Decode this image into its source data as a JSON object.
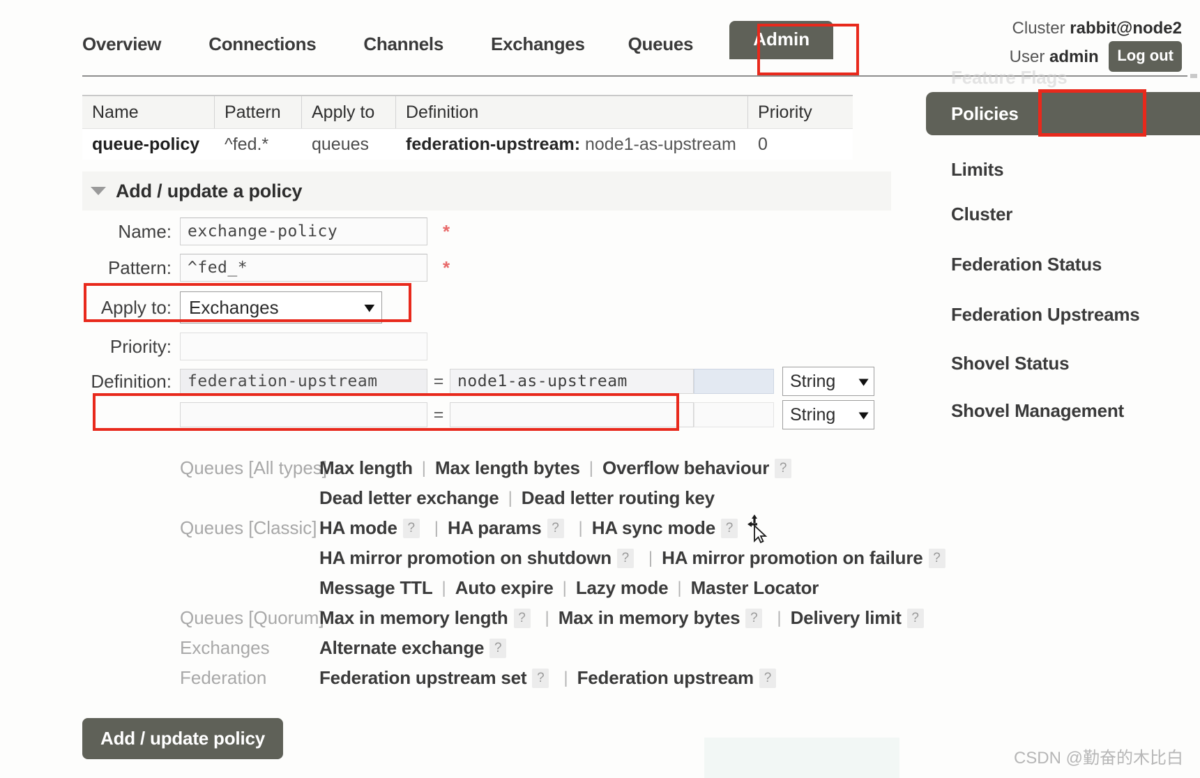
{
  "header": {
    "nav_tabs": [
      {
        "label": "Overview",
        "active": false
      },
      {
        "label": "Connections",
        "active": false
      },
      {
        "label": "Channels",
        "active": false
      },
      {
        "label": "Exchanges",
        "active": false
      },
      {
        "label": "Queues",
        "active": false
      },
      {
        "label": "Admin",
        "active": true
      }
    ],
    "cluster_label": "Cluster",
    "cluster_name": "rabbit@node2",
    "user_label": "User",
    "user_name": "admin",
    "logout_label": "Log out"
  },
  "sidebar": {
    "partial_top_item": "Feature Flags",
    "active_item": "Policies",
    "items": [
      {
        "label": "Limits"
      },
      {
        "label": "Cluster"
      },
      {
        "label": "Federation Status"
      },
      {
        "label": "Federation Upstreams"
      },
      {
        "label": "Shovel Status"
      },
      {
        "label": "Shovel Management"
      }
    ]
  },
  "policies_table": {
    "columns": [
      "Name",
      "Pattern",
      "Apply to",
      "Definition",
      "Priority"
    ],
    "rows": [
      {
        "name": "queue-policy",
        "pattern": "^fed.*",
        "apply_to": "queues",
        "definition_key": "federation-upstream:",
        "definition_value": "node1-as-upstream",
        "priority": "0"
      }
    ]
  },
  "form": {
    "section_title": "Add / update a policy",
    "name_label": "Name:",
    "name_value": "exchange-policy",
    "name_required": "*",
    "pattern_label": "Pattern:",
    "pattern_value": "^fed_*",
    "pattern_required": "*",
    "apply_to_label": "Apply to:",
    "apply_to_value": "Exchanges",
    "priority_label": "Priority:",
    "priority_value": "",
    "definition_label": "Definition:",
    "definition_rows": [
      {
        "key": "federation-upstream",
        "eq": "=",
        "value": "node1-as-upstream",
        "type": "String"
      },
      {
        "key": "",
        "eq": "=",
        "value": "",
        "type": "String"
      }
    ],
    "submit_label": "Add / update policy"
  },
  "param_groups": [
    {
      "category": "Queues [All types]",
      "lines": [
        [
          {
            "label": "Max length",
            "help": false
          },
          {
            "label": "Max length bytes",
            "help": false
          },
          {
            "label": "Overflow behaviour",
            "help": true
          }
        ],
        [
          {
            "label": "Dead letter exchange",
            "help": false
          },
          {
            "label": "Dead letter routing key",
            "help": false
          }
        ]
      ]
    },
    {
      "category": "Queues [Classic]",
      "lines": [
        [
          {
            "label": "HA mode",
            "help": true
          },
          {
            "label": "HA params",
            "help": true
          },
          {
            "label": "HA sync mode",
            "help": true
          }
        ],
        [
          {
            "label": "HA mirror promotion on shutdown",
            "help": true
          },
          {
            "label": "HA mirror promotion on failure",
            "help": true
          }
        ],
        [
          {
            "label": "Message TTL",
            "help": false
          },
          {
            "label": "Auto expire",
            "help": false
          },
          {
            "label": "Lazy mode",
            "help": false
          },
          {
            "label": "Master Locator",
            "help": false
          }
        ]
      ]
    },
    {
      "category": "Queues [Quorum]",
      "lines": [
        [
          {
            "label": "Max in memory length",
            "help": true
          },
          {
            "label": "Max in memory bytes",
            "help": true
          },
          {
            "label": "Delivery limit",
            "help": true
          }
        ]
      ]
    },
    {
      "category": "Exchanges",
      "lines": [
        [
          {
            "label": "Alternate exchange",
            "help": true
          }
        ]
      ]
    },
    {
      "category": "Federation",
      "lines": [
        [
          {
            "label": "Federation upstream set",
            "help": true
          },
          {
            "label": "Federation upstream",
            "help": true
          }
        ]
      ]
    }
  ],
  "icons": {
    "chevron_down": "⌄",
    "help": "?",
    "collapse_caret": "collapse-caret-icon"
  },
  "colors": {
    "accent_dark": "#5f6158",
    "highlight_red": "#e8291c",
    "required_star": "#e86a6a"
  },
  "watermark": {
    "text": "CSDN @勤奋的木比白"
  }
}
